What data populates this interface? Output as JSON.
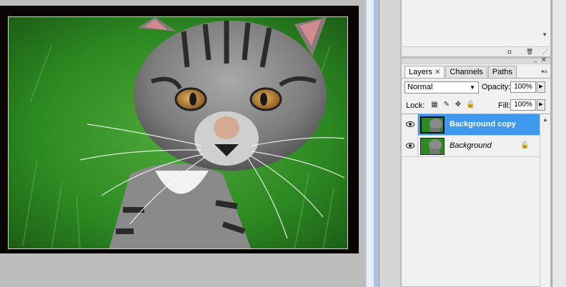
{
  "layers_panel": {
    "tabs": [
      {
        "label": "Layers",
        "active": true
      },
      {
        "label": "Channels",
        "active": false
      },
      {
        "label": "Paths",
        "active": false
      }
    ],
    "blend_mode": "Normal",
    "opacity_label": "Opacity:",
    "opacity_value": "100%",
    "lock_label": "Lock:",
    "fill_label": "Fill:",
    "fill_value": "100%",
    "layers": [
      {
        "name": "Background copy",
        "selected": true,
        "visible": true,
        "locked": false
      },
      {
        "name": "Background",
        "selected": false,
        "visible": true,
        "locked": true
      }
    ],
    "icons": {
      "lock_transparent": "checker-icon",
      "lock_paint": "brush-icon",
      "lock_position": "move-icon",
      "lock_all": "lock-icon"
    }
  },
  "colors": {
    "selection": "#3d98ee",
    "divider_blue": "#a9c4e3",
    "canvas_bg": "#bdbdbd"
  }
}
